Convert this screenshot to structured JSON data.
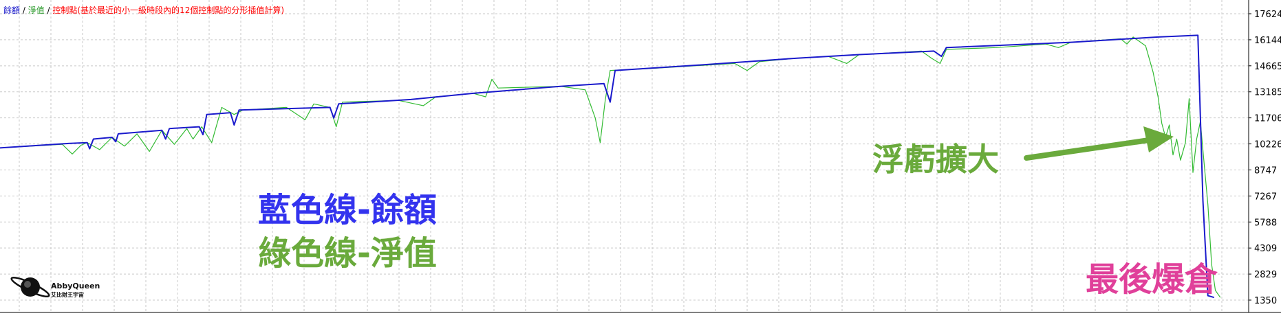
{
  "legend": {
    "balance_label": "餘額",
    "sep1": " / ",
    "equity_label": "淨值",
    "sep2": " / ",
    "control_label": "控制點(基於最近的小一級時段內的12個控制點的分形插值計算)"
  },
  "annotations": {
    "blue_line_label": "藍色線-餘額",
    "green_line_label": "綠色線-淨值",
    "floating_loss": "浮虧擴大",
    "blowup": "最後爆倉"
  },
  "logo": {
    "line1": "AbbyQueen",
    "line2": "艾比財王宇宙"
  },
  "colors": {
    "balance": "#1a1acc",
    "equity": "#33bb33",
    "control": "#ff0000",
    "ann_blue": "#3333ee",
    "ann_green": "#6aaa3c",
    "ann_pink": "#e0409a",
    "grid": "#c9c9c9"
  },
  "chart_data": {
    "type": "line",
    "ylim": [
      1350,
      17624
    ],
    "yticks": [
      17624,
      16144,
      14665,
      13185,
      11706,
      10226,
      8747,
      7267,
      5788,
      4309,
      2829,
      1350
    ],
    "xlim": [
      0,
      1000
    ],
    "series": [
      {
        "name": "餘額",
        "color": "#1a1acc",
        "points": [
          [
            0,
            10000
          ],
          [
            55,
            10250
          ],
          [
            70,
            10300
          ],
          [
            72,
            9950
          ],
          [
            75,
            10500
          ],
          [
            90,
            10600
          ],
          [
            93,
            10350
          ],
          [
            95,
            10800
          ],
          [
            130,
            11000
          ],
          [
            133,
            10500
          ],
          [
            136,
            11100
          ],
          [
            160,
            11200
          ],
          [
            163,
            10750
          ],
          [
            166,
            11900
          ],
          [
            185,
            12000
          ],
          [
            188,
            11300
          ],
          [
            192,
            12150
          ],
          [
            265,
            12300
          ],
          [
            268,
            11700
          ],
          [
            272,
            12500
          ],
          [
            330,
            12750
          ],
          [
            380,
            13100
          ],
          [
            450,
            13500
          ],
          [
            485,
            13650
          ],
          [
            490,
            12600
          ],
          [
            494,
            14400
          ],
          [
            560,
            14700
          ],
          [
            640,
            15100
          ],
          [
            690,
            15300
          ],
          [
            750,
            15500
          ],
          [
            756,
            15200
          ],
          [
            760,
            15700
          ],
          [
            860,
            16000
          ],
          [
            930,
            16300
          ],
          [
            962,
            16400
          ],
          [
            966,
            7000
          ],
          [
            970,
            1600
          ],
          [
            975,
            1500
          ]
        ]
      },
      {
        "name": "淨值",
        "color": "#33bb33",
        "points": [
          [
            0,
            10000
          ],
          [
            50,
            10200
          ],
          [
            58,
            9650
          ],
          [
            65,
            10150
          ],
          [
            70,
            10300
          ],
          [
            80,
            9900
          ],
          [
            90,
            10600
          ],
          [
            100,
            10100
          ],
          [
            110,
            10800
          ],
          [
            120,
            9800
          ],
          [
            130,
            11000
          ],
          [
            140,
            10200
          ],
          [
            150,
            11100
          ],
          [
            155,
            10500
          ],
          [
            162,
            11200
          ],
          [
            170,
            10300
          ],
          [
            178,
            12300
          ],
          [
            188,
            11900
          ],
          [
            195,
            12150
          ],
          [
            230,
            12300
          ],
          [
            245,
            11600
          ],
          [
            252,
            12500
          ],
          [
            265,
            12300
          ],
          [
            270,
            11200
          ],
          [
            275,
            12600
          ],
          [
            320,
            12700
          ],
          [
            340,
            12400
          ],
          [
            350,
            12900
          ],
          [
            380,
            13100
          ],
          [
            390,
            12900
          ],
          [
            395,
            13900
          ],
          [
            400,
            13400
          ],
          [
            450,
            13500
          ],
          [
            470,
            13300
          ],
          [
            478,
            11700
          ],
          [
            482,
            10300
          ],
          [
            486,
            12700
          ],
          [
            490,
            14400
          ],
          [
            520,
            14500
          ],
          [
            590,
            14800
          ],
          [
            600,
            14400
          ],
          [
            610,
            14900
          ],
          [
            640,
            15100
          ],
          [
            665,
            15200
          ],
          [
            680,
            14800
          ],
          [
            690,
            15300
          ],
          [
            740,
            15500
          ],
          [
            748,
            15100
          ],
          [
            755,
            14800
          ],
          [
            760,
            15600
          ],
          [
            800,
            15700
          ],
          [
            840,
            15900
          ],
          [
            850,
            15700
          ],
          [
            860,
            16000
          ],
          [
            900,
            16200
          ],
          [
            905,
            15900
          ],
          [
            910,
            16300
          ],
          [
            920,
            15800
          ],
          [
            926,
            14300
          ],
          [
            930,
            12900
          ],
          [
            933,
            11400
          ],
          [
            936,
            10600
          ],
          [
            939,
            11300
          ],
          [
            942,
            9600
          ],
          [
            945,
            10500
          ],
          [
            948,
            9300
          ],
          [
            952,
            10300
          ],
          [
            955,
            12800
          ],
          [
            958,
            8600
          ],
          [
            961,
            10500
          ],
          [
            964,
            11500
          ],
          [
            967,
            9100
          ],
          [
            970,
            6800
          ],
          [
            973,
            3400
          ],
          [
            976,
            1900
          ],
          [
            980,
            1500
          ]
        ]
      }
    ]
  }
}
